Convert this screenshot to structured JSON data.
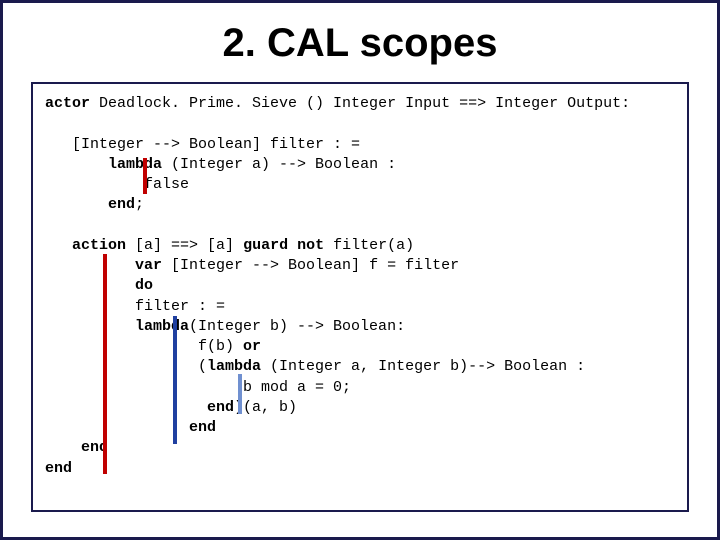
{
  "title": "2. CAL scopes",
  "code": {
    "l1a": "actor",
    "l1b": " Deadlock. Prime. Sieve () Integer Input ==> Integer Output:",
    "l2": "   [Integer --> Boolean] filter : =",
    "l3a": "       ",
    "l3b": "lambda",
    "l3c": " (Integer a) --> Boolean :",
    "l4": "           false",
    "l5a": "       ",
    "l5b": "end",
    "l5c": ";",
    "l6a": "   ",
    "l6b": "action",
    "l6c": " [a] ==> [a] ",
    "l6d": "guard not",
    "l6e": " filter(a)",
    "l7a": "          ",
    "l7b": "var",
    "l7c": " [Integer --> Boolean] f = filter",
    "l8a": "          ",
    "l8b": "do",
    "l9": "          filter : =",
    "l10a": "          ",
    "l10b": "lambda",
    "l10c": "(Integer b) --> Boolean:",
    "l11a": "                 f(b) ",
    "l11b": "or",
    "l12a": "                 (",
    "l12b": "lambda",
    "l12c": " (Integer a, Integer b)--> Boolean :",
    "l13": "                      b mod a = 0;",
    "l14a": "                  ",
    "l14b": "end",
    "l14c": ")(a, b)",
    "l15a": "                ",
    "l15b": "end",
    "l16a": "    ",
    "l16b": "end",
    "l17a": "",
    "l17b": "end"
  }
}
